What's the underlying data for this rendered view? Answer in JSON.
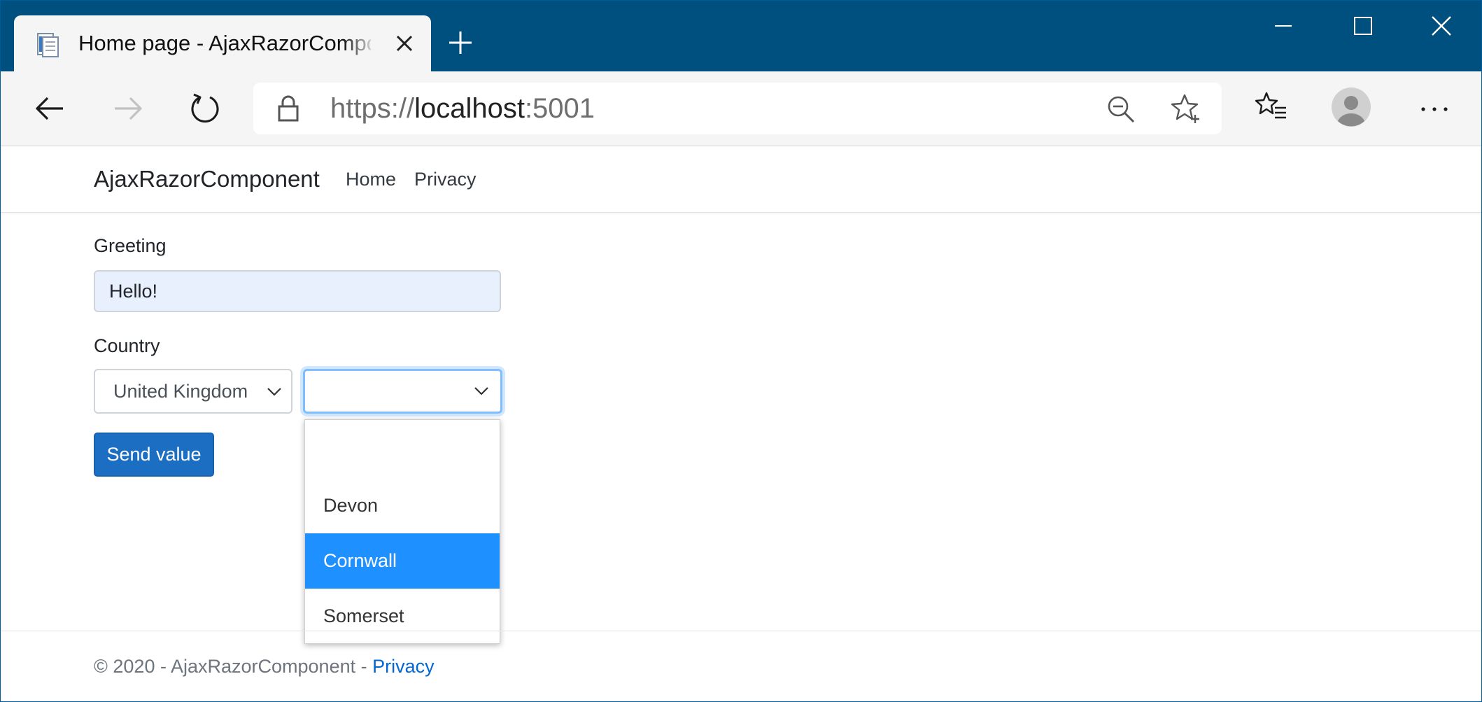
{
  "browser": {
    "tab_title": "Home page - AjaxRazorComponent",
    "url_scheme": "https://",
    "url_host": "localhost",
    "url_port": ":5001",
    "accent_color": "#00507f",
    "icons": [
      "page-icon",
      "close-icon",
      "plus-icon",
      "minimize-icon",
      "maximize-icon",
      "window-close-icon",
      "back-arrow-icon",
      "forward-arrow-icon",
      "refresh-icon",
      "lock-icon",
      "zoom-out-icon",
      "add-favorite-icon",
      "favorites-icon",
      "profile-icon",
      "more-icon"
    ]
  },
  "site": {
    "brand": "AjaxRazorComponent",
    "nav": {
      "home": "Home",
      "privacy": "Privacy"
    }
  },
  "form": {
    "greeting_label": "Greeting",
    "greeting_value": "Hello!",
    "country_label": "Country",
    "country_selected": "United Kingdom",
    "region_selected": "",
    "region_options": [
      "",
      "Devon",
      "Cornwall",
      "Somerset"
    ],
    "region_highlighted": "Cornwall",
    "send_label": "Send value",
    "button_color": "#1b6ec2",
    "highlight_color": "#1e90ff"
  },
  "footer": {
    "text": "© 2020 - AjaxRazorComponent - ",
    "link": "Privacy"
  }
}
